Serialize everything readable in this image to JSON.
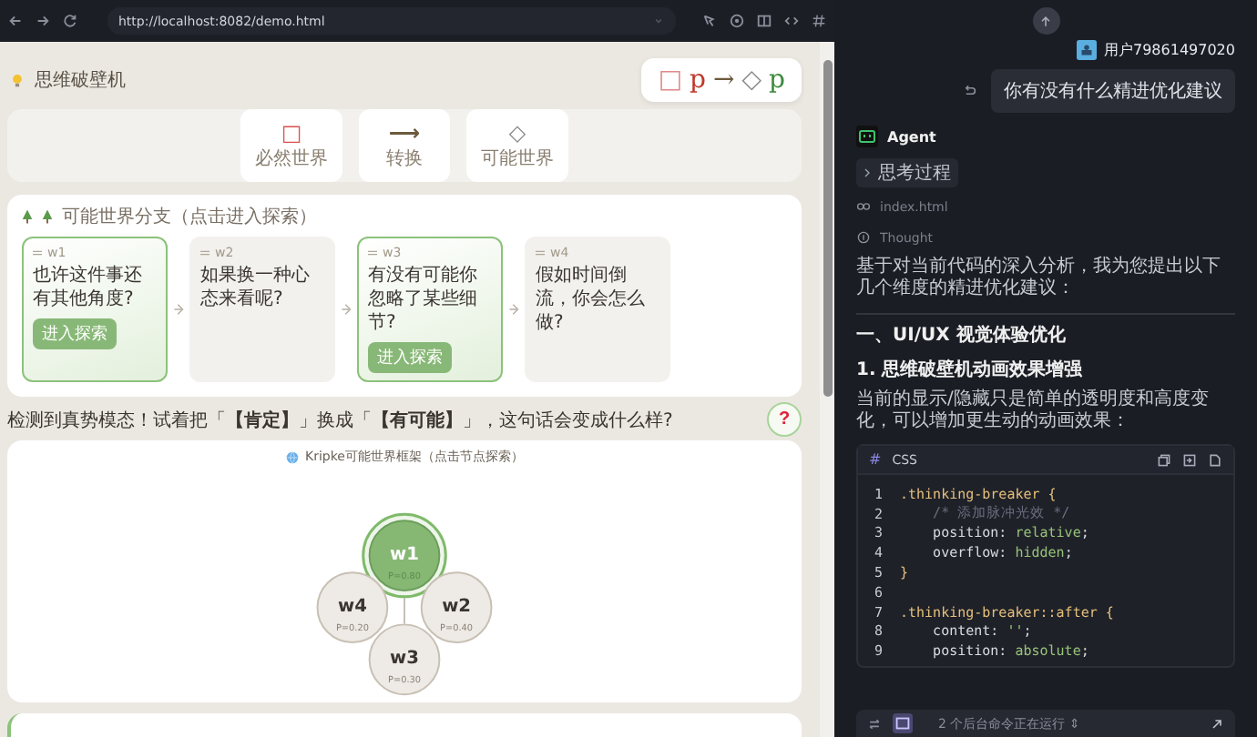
{
  "browser": {
    "url": "http://localhost:8082/demo.html"
  },
  "page": {
    "title": "思维破壁机",
    "formula": [
      {
        "text": "□",
        "color": "#e08a8a"
      },
      {
        "text": "p",
        "color": "#c0392b"
      },
      {
        "text": "→",
        "color": "#6b5a3c"
      },
      {
        "text": "◇",
        "color": "#8a8a8a"
      },
      {
        "text": "p",
        "color": "#3c8a3c"
      }
    ],
    "modes": [
      {
        "icon": "□",
        "label": "必然世界",
        "color": "#d9534f"
      },
      {
        "icon": "⟶",
        "label": "转换",
        "color": "#6b5a3c"
      },
      {
        "icon": "◇",
        "label": "可能世界",
        "color": "#888888"
      }
    ],
    "branches_title": "可能世界分支（点击进入探索）",
    "branches": [
      {
        "id": "w1",
        "question": "也许这件事还有其他角度?",
        "selected": true,
        "action": "进入探索"
      },
      {
        "id": "w2",
        "question": "如果换一种心态来看呢?",
        "selected": false
      },
      {
        "id": "w3",
        "question": "有没有可能你忽略了某些细节?",
        "selected": true,
        "action": "进入探索"
      },
      {
        "id": "w4",
        "question": "假如时间倒流，你会怎么做?",
        "selected": false
      }
    ],
    "hint": "检测到真势模态！试着把「**【肯定】**」换成「**【有可能】**」，这句话会变成什么样?",
    "help": "?",
    "kripke_title": "Kripke可能世界框架（点击节点探索）",
    "worlds": [
      {
        "id": "w1",
        "p": "P=0.80",
        "selected": true
      },
      {
        "id": "w2",
        "p": "P=0.40",
        "selected": false
      },
      {
        "id": "w3",
        "p": "P=0.30",
        "selected": false
      },
      {
        "id": "w4",
        "p": "P=0.20",
        "selected": false
      }
    ]
  },
  "chat": {
    "user": "用户79861497020",
    "message": "你有没有什么精进优化建议",
    "agent": "Agent",
    "steps": [
      {
        "kind": "toggle",
        "text": "思考过程"
      },
      {
        "kind": "file",
        "text": "index.html"
      },
      {
        "kind": "thought",
        "text": "Thought"
      }
    ],
    "intro": "基于对当前代码的深入分析，我为您提出以下几个维度的精进优化建议：",
    "h2": "一、UI/UX 视觉体验优化",
    "h3": "1. 思维破壁机动画效果增强",
    "para": "当前的显示/隐藏只是简单的透明度和高度变化，可以增加更生动的动画效果：",
    "code": {
      "lang": "CSS",
      "hash": "#",
      "lines": [
        {
          "n": "1",
          "tokens": [
            {
              "kind": "sel",
              "text": ".thinking-breaker"
            },
            {
              "kind": "brace",
              "text": " {"
            }
          ]
        },
        {
          "n": "2",
          "tokens": [
            {
              "kind": "comment",
              "text": "    /* 添加脉冲光效 */"
            }
          ]
        },
        {
          "n": "3",
          "tokens": [
            {
              "kind": "prop",
              "text": "    position: "
            },
            {
              "kind": "val",
              "text": "relative"
            },
            {
              "kind": "prop",
              "text": ";"
            }
          ]
        },
        {
          "n": "4",
          "tokens": [
            {
              "kind": "prop",
              "text": "    overflow: "
            },
            {
              "kind": "val",
              "text": "hidden"
            },
            {
              "kind": "prop",
              "text": ";"
            }
          ]
        },
        {
          "n": "5",
          "tokens": [
            {
              "kind": "brace",
              "text": "}"
            }
          ]
        },
        {
          "n": "6"
        },
        {
          "n": "7",
          "tokens": [
            {
              "kind": "sel",
              "text": ".thinking-breaker::after"
            },
            {
              "kind": "brace",
              "text": " {"
            }
          ]
        },
        {
          "n": "8",
          "tokens": [
            {
              "kind": "prop",
              "text": "    content: "
            },
            {
              "kind": "val",
              "text": "''"
            },
            {
              "kind": "prop",
              "text": ";"
            }
          ]
        },
        {
          "n": "9",
          "tokens": [
            {
              "kind": "prop",
              "text": "    position: "
            },
            {
              "kind": "val",
              "text": "absolute"
            },
            {
              "kind": "prop",
              "text": ";"
            }
          ]
        }
      ]
    },
    "status": "2 个后台命令正在运行 ⇕"
  }
}
